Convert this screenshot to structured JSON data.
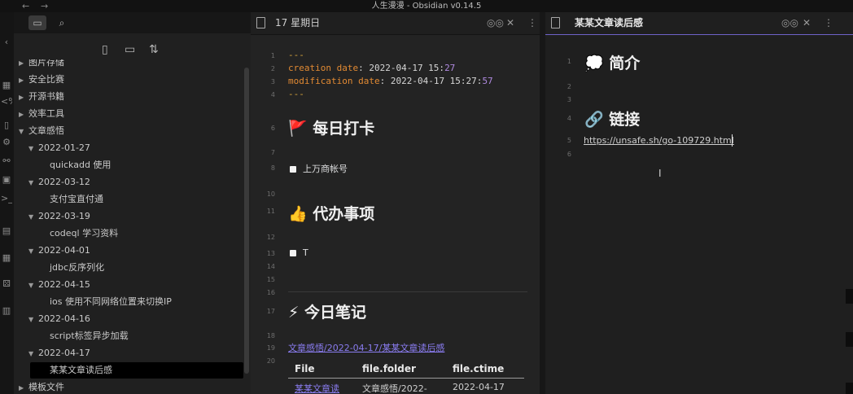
{
  "window": {
    "title": "人生漫漫 - Obsidian v0.14.5",
    "back_glyph": "←",
    "forward_glyph": "→"
  },
  "ribbon": {
    "icons": [
      {
        "name": "collapse-icon",
        "glyph": "‹"
      },
      {
        "name": "table-icon",
        "glyph": "▦"
      },
      {
        "name": "code-icon",
        "glyph": "<%"
      },
      {
        "name": "file-icon",
        "glyph": "▯"
      },
      {
        "name": "gear-icon",
        "glyph": "⚙"
      },
      {
        "name": "graph-icon",
        "glyph": "⚯"
      },
      {
        "name": "calendar-icon",
        "glyph": "▣"
      },
      {
        "name": "terminal-icon",
        "glyph": ">_"
      },
      {
        "name": "archive-icon",
        "glyph": "▤"
      },
      {
        "name": "blocks-icon",
        "glyph": "▦"
      },
      {
        "name": "dice-icon",
        "glyph": "⚄"
      },
      {
        "name": "template-icon",
        "glyph": "▥"
      }
    ]
  },
  "sidebar": {
    "tab_icons": {
      "folder": "▭",
      "search": "⌕"
    },
    "action_icons": {
      "new_note": "▯",
      "new_folder": "▭",
      "sort": "⇅"
    },
    "tree": [
      {
        "label": "图片存储",
        "level": 0,
        "arrow": "▶"
      },
      {
        "label": "安全比赛",
        "level": 0,
        "arrow": "▶"
      },
      {
        "label": "开源书籍",
        "level": 0,
        "arrow": "▶"
      },
      {
        "label": "效率工具",
        "level": 0,
        "arrow": "▶"
      },
      {
        "label": "文章感悟",
        "level": 0,
        "arrow": "▼"
      },
      {
        "label": "2022-01-27",
        "level": 1,
        "arrow": "▼"
      },
      {
        "label": "quickadd 使用",
        "level": 2,
        "arrow": ""
      },
      {
        "label": "2022-03-12",
        "level": 1,
        "arrow": "▼"
      },
      {
        "label": "支付宝直付通",
        "level": 2,
        "arrow": ""
      },
      {
        "label": "2022-03-19",
        "level": 1,
        "arrow": "▼"
      },
      {
        "label": "codeql 学习资料",
        "level": 2,
        "arrow": ""
      },
      {
        "label": "2022-04-01",
        "level": 1,
        "arrow": "▼"
      },
      {
        "label": "jdbc反序列化",
        "level": 2,
        "arrow": ""
      },
      {
        "label": "2022-04-15",
        "level": 1,
        "arrow": "▼"
      },
      {
        "label": "ios 使用不同网络位置来切换IP",
        "level": 2,
        "arrow": ""
      },
      {
        "label": "2022-04-16",
        "level": 1,
        "arrow": "▼"
      },
      {
        "label": "script标签异步加载",
        "level": 2,
        "arrow": ""
      },
      {
        "label": "2022-04-17",
        "level": 1,
        "arrow": "▼"
      },
      {
        "label": "某某文章读后感",
        "level": 2,
        "arrow": "",
        "selected": true
      },
      {
        "label": "模板文件",
        "level": 0,
        "arrow": "▶"
      }
    ]
  },
  "left_pane": {
    "title": "17 星期日",
    "reading_icon": "◎◎",
    "close_icon": "✕",
    "more_icon": "⋮",
    "line_numbers": [
      "1",
      "2",
      "3",
      "4",
      "6",
      "7",
      "8",
      "10",
      "11",
      "12",
      "13",
      "14",
      "15",
      "16",
      "17",
      "18",
      "19",
      "20"
    ],
    "frontmatter": {
      "dash": "---",
      "created_key": "creation date",
      "created_val": ": 2022-04-17 15:",
      "created_min": "27",
      "modified_key": "modification date",
      "modified_val": ": 2022-04-17 15:27:",
      "modified_sec": "57"
    },
    "h_checkin_emoji": "🚩",
    "h_checkin": "每日打卡",
    "task1": "上万商帐号",
    "h_todo_emoji": "👍",
    "h_todo": "代办事项",
    "task2": "T",
    "h_notes_emoji": "⚡",
    "h_notes": "今日笔记",
    "note_link": "文章感悟/2022-04-17/某某文章读后感",
    "table": {
      "headers": [
        "File",
        "file.folder",
        "file.ctime"
      ],
      "row": [
        "某某文章读",
        "文章感悟/2022-",
        "2022-04-17"
      ]
    }
  },
  "right_pane": {
    "title": "某某文章读后感",
    "reading_icon": "◎◎",
    "close_icon": "✕",
    "more_icon": "⋮",
    "line_numbers": [
      "1",
      "2",
      "3",
      "4",
      "5",
      "6"
    ],
    "h_intro_emoji": "💭",
    "h_intro": "简介",
    "h_links_emoji": "🔗",
    "h_links": "链接",
    "url": "https://unsafe.sh/go-109729.html",
    "cursor": "I"
  }
}
